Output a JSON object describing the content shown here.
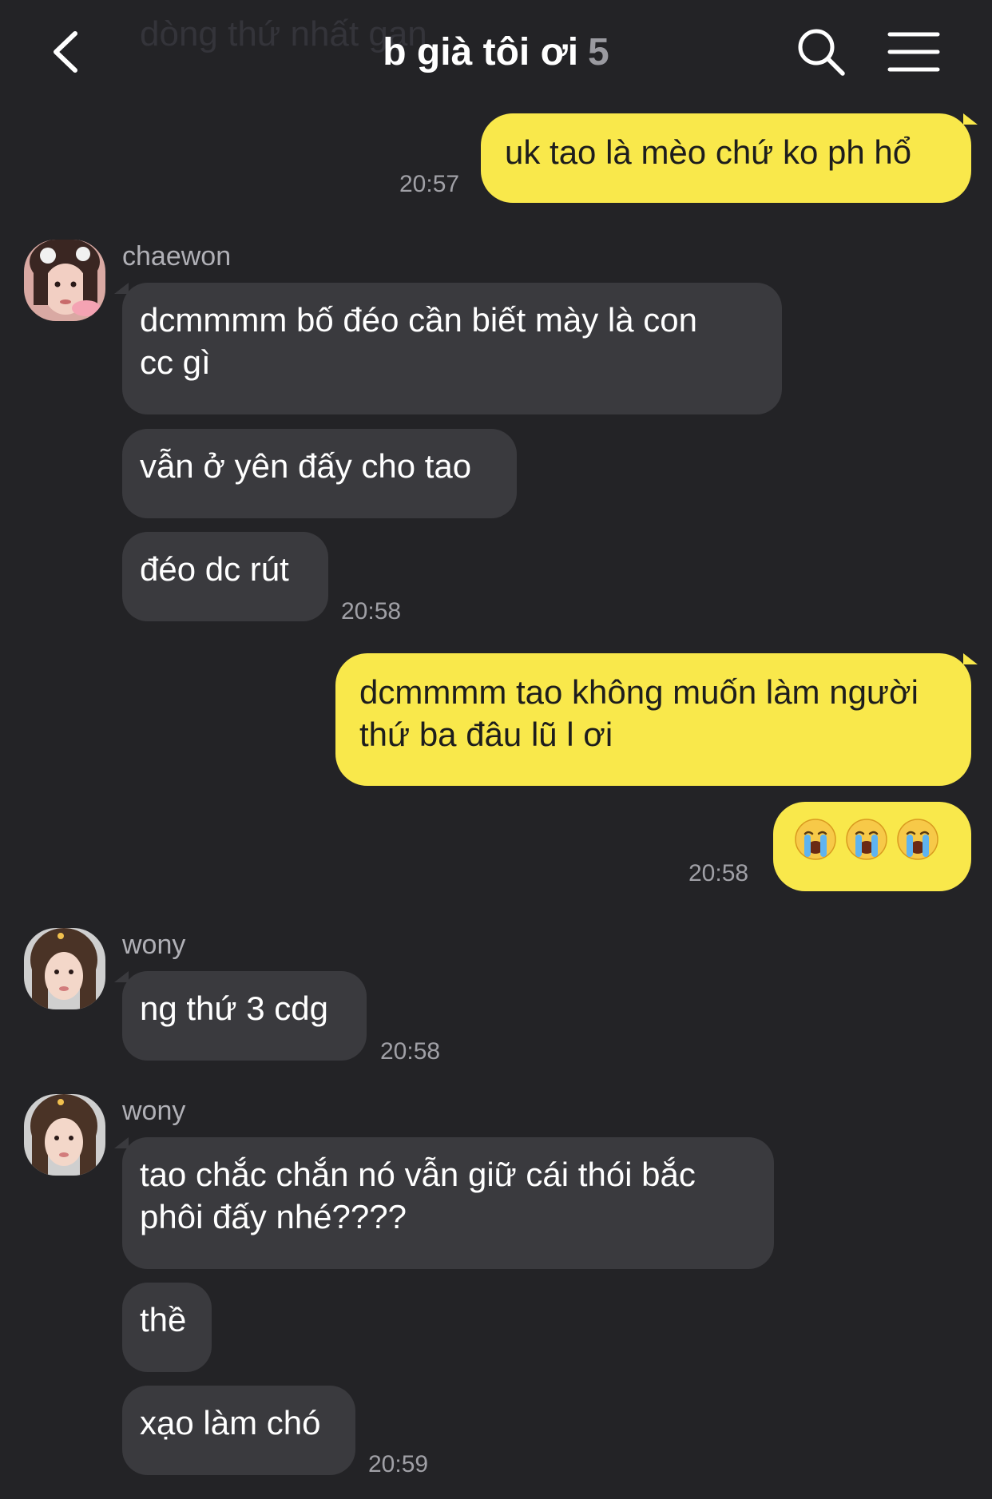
{
  "header": {
    "ghost_text": "dòng thứ nhất gạn",
    "title": "b già tôi ơi",
    "member_count": "5",
    "icons": {
      "back": "chevron-left-icon",
      "search": "search-icon",
      "menu": "hamburger-menu-icon"
    }
  },
  "messages": {
    "m1": {
      "text": "uk tao là mèo chứ ko ph hổ",
      "time": "20:57"
    },
    "g1": {
      "sender": "chaewon",
      "b1": "dcmmmm bố đéo cần biết mày là con",
      "b1b": "cc gì",
      "b2": "vẫn ở yên đấy cho tao",
      "b3": "đéo dc rút",
      "time": "20:58"
    },
    "m2": {
      "line1": "dcmmmm tao không muốn làm người",
      "line2": "thứ ba đâu lũ l ơi",
      "emoji": [
        "loudly-crying-face",
        "loudly-crying-face",
        "loudly-crying-face"
      ],
      "time": "20:58"
    },
    "g2": {
      "sender": "wony",
      "b1": "ng thứ 3 cdg",
      "time": "20:58"
    },
    "g3": {
      "sender": "wony",
      "b1": "tao chắc chắn nó vẫn giữ cái thói bắc",
      "b1b": "phôi đấy nhé????",
      "b2": "thề",
      "b3": "xạo làm chó",
      "time": "20:59"
    }
  },
  "colors": {
    "background": "#232326",
    "my_bubble": "#f9e84b",
    "their_bubble": "#3a3a3e",
    "timestamp": "#a0a0a6"
  }
}
